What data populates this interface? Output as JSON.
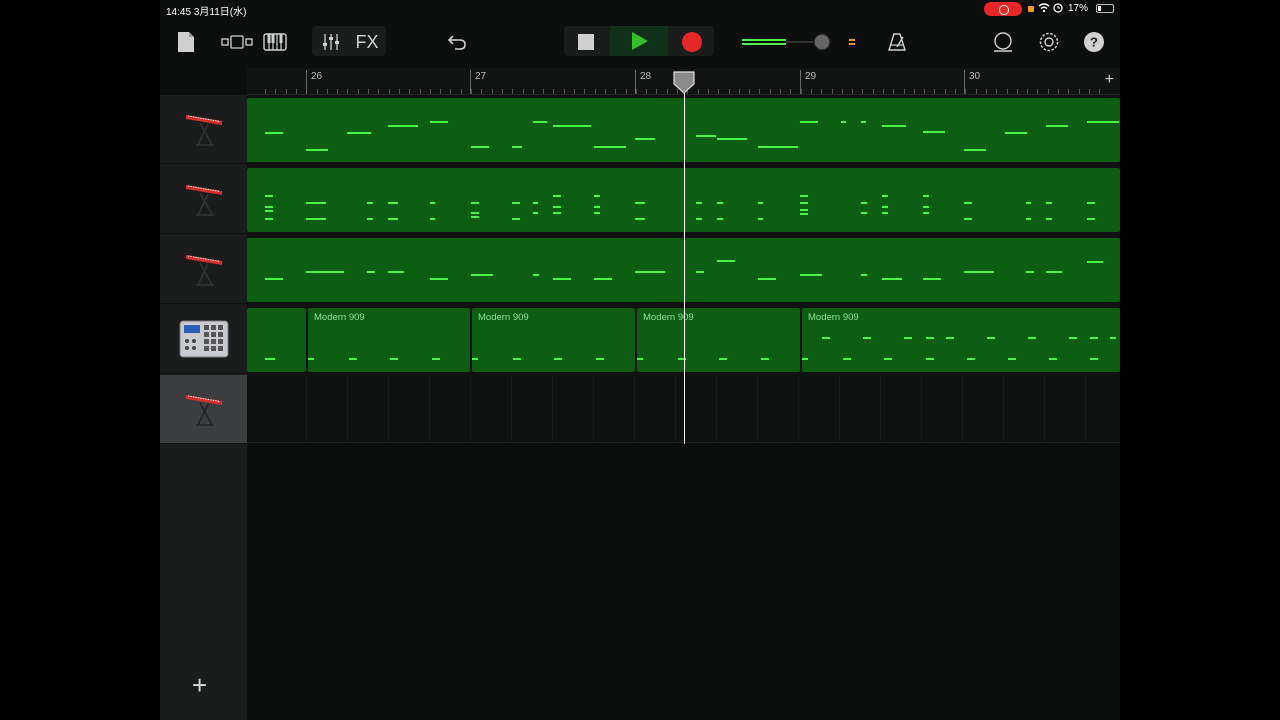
{
  "status_bar": {
    "time": "14:45",
    "date": "3月11日(水)",
    "battery": "17%"
  },
  "toolbar": {
    "icons": [
      "document-icon",
      "view-toggle-icon",
      "keyboard-icon",
      "mixer-icon",
      "undo-icon",
      "stop-icon",
      "play-icon",
      "record-icon",
      "volume-slider",
      "count-in-icon",
      "metronome-icon",
      "loop-icon",
      "settings-icon",
      "help-icon"
    ],
    "fx_label": "FX",
    "help_label": "?",
    "volume_level": 0.5
  },
  "ruler": {
    "bars": [
      "26",
      "27",
      "28",
      "29",
      "30"
    ],
    "add_label": "+"
  },
  "tracks": [
    {
      "instrument": "keyboard",
      "regions": [
        {
          "name": ""
        }
      ]
    },
    {
      "instrument": "keyboard",
      "regions": [
        {
          "name": ""
        }
      ]
    },
    {
      "instrument": "keyboard",
      "regions": [
        {
          "name": ""
        }
      ]
    },
    {
      "instrument": "drum-machine",
      "regions": [
        {
          "name": ""
        },
        {
          "name": "Modern 909"
        },
        {
          "name": "Modern 909"
        },
        {
          "name": "Modern 909"
        },
        {
          "name": "Modern 909"
        }
      ]
    },
    {
      "instrument": "keyboard",
      "regions": [],
      "selected": true
    }
  ],
  "add_track_label": "+",
  "colors": {
    "region": "#0b5e12",
    "note": "#4cf24c",
    "record": "#e52727",
    "play": "#35c12b"
  }
}
